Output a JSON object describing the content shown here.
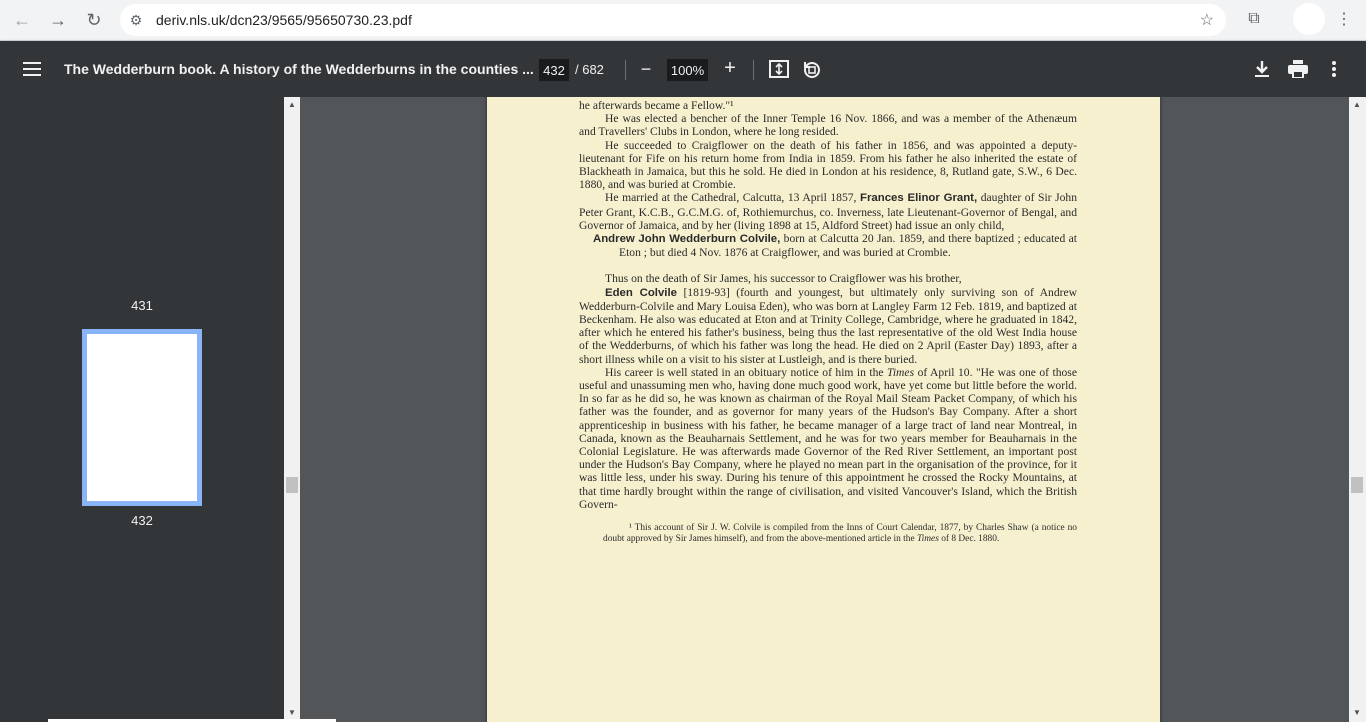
{
  "browser": {
    "url": "deriv.nls.uk/dcn23/9565/95650730.23.pdf",
    "back_icon": "←",
    "forward_icon": "→",
    "reload_icon": "↻",
    "site_info_icon": "⚙",
    "bookmark_icon": "☆",
    "extensions_icon": "⧉",
    "menu_icon": "⋮"
  },
  "toolbar": {
    "title": "The Wedderburn book. A history of the Wedderburns in the counties ...",
    "current_page": "432",
    "total_pages": "/ 682",
    "zoom": "100%",
    "zoom_out_icon": "−",
    "zoom_in_icon": "+"
  },
  "sidebar": {
    "thumb_labels": [
      "431",
      "432"
    ]
  },
  "document": {
    "line0": "he afterwards became a Fellow.\"¹",
    "p1": "He was elected a bencher of the Inner Temple 16 Nov. 1866, and was a member of the Athenæum and Travellers' Clubs in London, where he long resided.",
    "p2": "He succeeded to Craigflower on the death of his father in 1856, and was appointed a deputy-lieutenant for Fife on his return home from India in 1859. From his father he also inherited the estate of Blackheath in Jamaica, but this he sold. He died in London at his residence, 8, Rutland gate, S.W., 6 Dec. 1880, and was buried at Crombie.",
    "p3_a": "He married at the Cathedral, Calcutta, 13 April 1857,",
    "p3_name": "Frances Elinor Grant,",
    "p3_b": "daughter of Sir John Peter Grant, K.C.B., G.C.M.G. of, Rothiemurchus, co. Inverness, late Lieutenant-Governor of Bengal, and Governor of Jamaica, and by her (living 1898 at 15, Aldford Street) had issue an only child,",
    "child_name": "Andrew John Wedderburn Colvile,",
    "child_text": "born at Calcutta 20 Jan. 1859, and there baptized ; educated at Eton ; but died 4 Nov. 1876 at Craigflower, and was buried at Crombie.",
    "p4": "Thus on the death of Sir James, his successor to Craigflower was his brother,",
    "p5_name": "Eden Colvile",
    "p5_text": "[1819-93] (fourth and youngest, but ultimately only surviving son of Andrew Wedderburn-Colvile and Mary Louisa Eden), who was born at Langley Farm 12 Feb. 1819, and baptized at Beckenham. He also was educated at Eton and at Trinity College, Cambridge, where he graduated in 1842, after which he entered his father's business, being thus the last representative of the old West India house of the Wedderburns, of which his father was long the head. He died on 2 April (Easter Day) 1893, after a short illness while on a visit to his sister at Lustleigh, and is there buried.",
    "p6_a": "His career is well stated in an obituary notice of him in the",
    "p6_times": "Times",
    "p6_b": "of April 10. \"He was one of those useful and unassuming men who, having done much good work, have yet come but little before the world. In so far as he did so, he was known as chairman of the Royal Mail Steam Packet Company, of which his father was the founder, and as governor for many years of the Hudson's Bay Company. After a short apprenticeship in business with his father, he became manager of a large tract of land near Montreal, in Canada, known as the Beauharnais Settlement, and he was for two years member for Beauharnais in the Colonial Legislature. He was afterwards made Governor of the Red River Settlement, an important post under the Hudson's Bay Company, where he played no mean part in the organisation of the province, for it was little less, under his sway. During his tenure of this appointment he crossed the Rocky Mountains, at that time hardly brought within the range of civilisation, and visited Vancouver's Island, which the British Govern-",
    "footnote_a": "¹ This account of Sir J. W. Colvile is compiled from the Inns of Court Calendar, 1877, by Charles Shaw (a notice no doubt approved by Sir James himself), and from the above-mentioned article in the",
    "footnote_times": "Times",
    "footnote_b": "of 8 Dec. 1880."
  }
}
